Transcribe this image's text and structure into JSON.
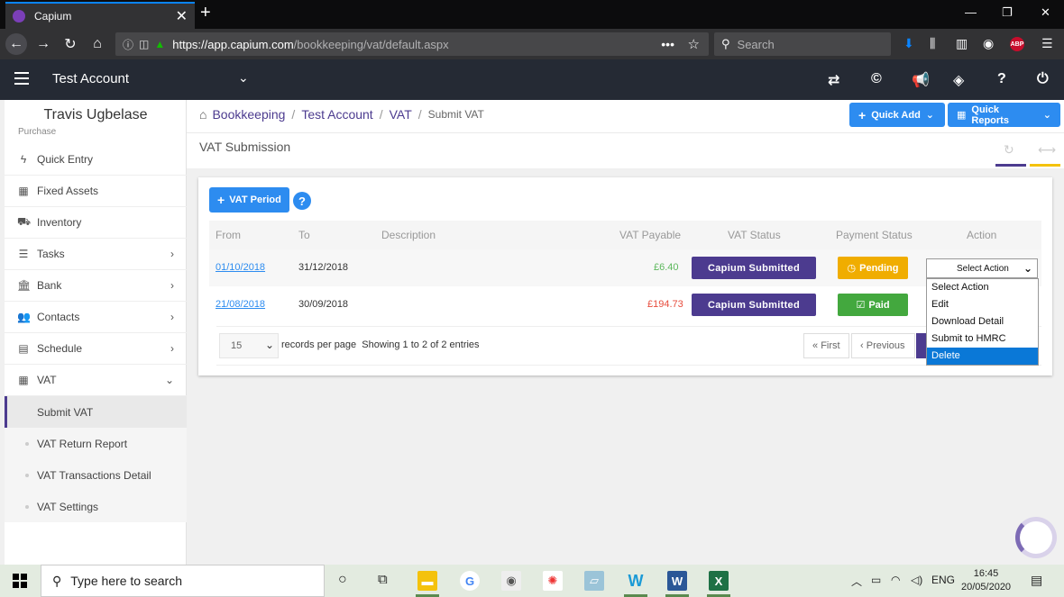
{
  "browser": {
    "tab_title": "Capium",
    "url_host": "https://app.capium.com",
    "url_path": "/bookkeeping/vat/default.aspx",
    "search_placeholder": "Search",
    "abp_label": "ABP"
  },
  "header": {
    "account_name": "Test Account"
  },
  "sidebar": {
    "user_name": "Travis Ugbelase",
    "cut_item": "Purchase",
    "items": [
      {
        "label": "Quick Entry",
        "icon": "bolt-icon"
      },
      {
        "label": "Fixed Assets",
        "icon": "building-icon"
      },
      {
        "label": "Inventory",
        "icon": "truck-icon"
      },
      {
        "label": "Tasks",
        "icon": "list-icon"
      },
      {
        "label": "Bank",
        "icon": "bank-icon"
      },
      {
        "label": "Contacts",
        "icon": "users-icon"
      },
      {
        "label": "Schedule",
        "icon": "calendar-icon"
      },
      {
        "label": "VAT",
        "icon": "calculator-icon"
      }
    ],
    "vat_sub": [
      "Submit VAT",
      "VAT Return Report",
      "VAT Transactions Detail",
      "VAT Settings"
    ]
  },
  "breadcrumb": {
    "items": [
      "Bookkeeping",
      "Test Account",
      "VAT"
    ],
    "current": "Submit VAT"
  },
  "buttons": {
    "quick_add": "Quick Add",
    "quick_reports": "Quick Reports",
    "vat_period": "VAT Period",
    "help": "?"
  },
  "page_title": "VAT Submission",
  "table": {
    "headers": [
      "From",
      "To",
      "Description",
      "VAT Payable",
      "VAT Status",
      "Payment Status",
      "Action"
    ],
    "rows": [
      {
        "from": "01/10/2018",
        "to": "31/12/2018",
        "description": "",
        "vat_payable": "£6.40",
        "vat_status": "Capium Submitted",
        "payment_status": "Pending"
      },
      {
        "from": "21/08/2018",
        "to": "30/09/2018",
        "description": "",
        "vat_payable": "£194.73",
        "vat_status": "Capium Submitted",
        "payment_status": "Paid"
      }
    ]
  },
  "footer": {
    "per_page": "15",
    "per_page_label": "records per page",
    "showing": "Showing 1 to 2 of 2 entries",
    "first": "First",
    "previous": "Previous"
  },
  "action_select": {
    "value": "Select Action",
    "options": [
      "Select Action",
      "Edit",
      "Download Detail",
      "Submit to HMRC",
      "Delete"
    ],
    "highlighted": "Delete"
  },
  "taskbar": {
    "search_placeholder": "Type here to search",
    "lang": "ENG",
    "time": "16:45",
    "date": "20/05/2020"
  },
  "colors": {
    "purple": "#4c3b8f",
    "blue": "#2d8cf0",
    "pending": "#f0ad00",
    "paid": "#43a83e"
  }
}
